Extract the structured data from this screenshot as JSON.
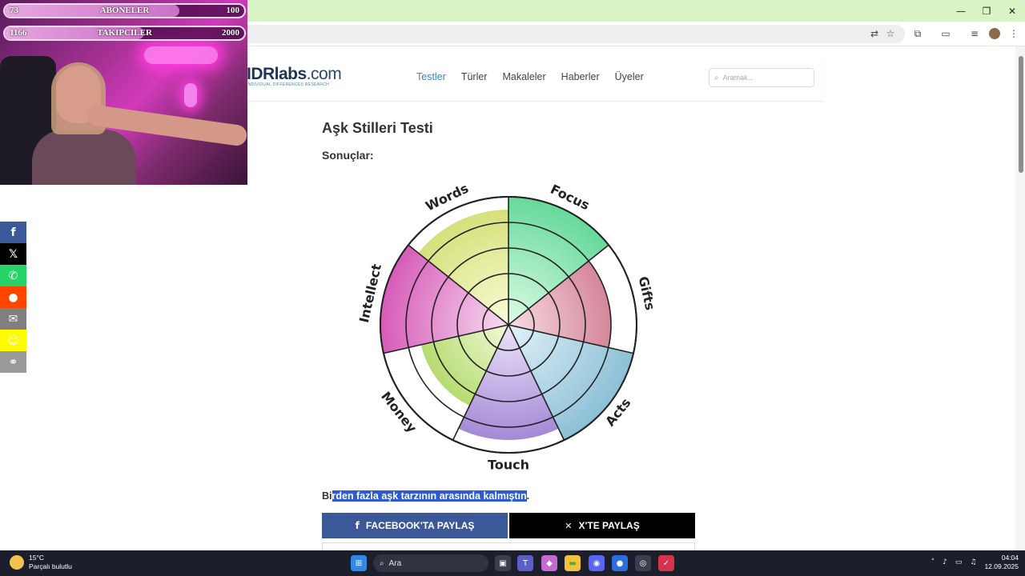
{
  "browser": {
    "window_controls": {
      "minimize": "—",
      "maximize": "❐",
      "close": "✕"
    }
  },
  "site": {
    "logo_main": "IDRlabs",
    "logo_ext": ".com",
    "logo_sub": "INDIVIDUAL DIFFERENCES RESEARCH",
    "nav": [
      "Testler",
      "Türler",
      "Makaleler",
      "Haberler",
      "Üyeler"
    ],
    "active_nav": "Testler",
    "search_placeholder": "Aramak..."
  },
  "content": {
    "title": "Aşk Stilleri Testi",
    "results_label": "Sonuçlar:",
    "result_prefix": "Bi",
    "result_selected": "rden fazla aşk tarzının arasında kalmıştın",
    "result_suffix": ".",
    "facebook_share": "FACEBOOK'TA PAYLAŞ",
    "x_share": "X'TE PAYLAŞ"
  },
  "chart_data": {
    "type": "polar-area",
    "levels": 5,
    "categories": [
      "Focus",
      "Gifts",
      "Acts",
      "Touch",
      "Money",
      "Intellect",
      "Words"
    ],
    "values": [
      5,
      4,
      5,
      4.5,
      3.5,
      5,
      4.5
    ],
    "max": 5,
    "colors": [
      "#66d99a",
      "#d5869a",
      "#8dc0d6",
      "#a48ad6",
      "#b6db70",
      "#d65cb8",
      "#d6e07a"
    ],
    "light_colors": [
      "#dffce6",
      "#f7dde2",
      "#e1f2f8",
      "#ece4fa",
      "#f0fad8",
      "#f8dcf1",
      "#fbfcd9"
    ]
  },
  "webcam": {
    "stats": [
      {
        "left": "73",
        "label": "ABONELER",
        "right": "100",
        "fill": 0.73
      },
      {
        "left": "1166",
        "label": "TAKIPCILER",
        "right": "2000",
        "fill": 0.583
      }
    ]
  },
  "social_icons": [
    {
      "name": "facebook-icon",
      "glyph": "f",
      "color": "#3b5998"
    },
    {
      "name": "x-icon",
      "glyph": "𝕏",
      "color": "#000000"
    },
    {
      "name": "whatsapp-icon",
      "glyph": "✆",
      "color": "#25d366"
    },
    {
      "name": "reddit-icon",
      "glyph": "●",
      "color": "#ff4500"
    },
    {
      "name": "email-icon",
      "glyph": "✉",
      "color": "#7f7f7f"
    },
    {
      "name": "snapchat-icon",
      "glyph": "☺",
      "color": "#fffc00"
    },
    {
      "name": "link-icon",
      "glyph": "⚭",
      "color": "#9a9a9a"
    }
  ],
  "taskbar": {
    "temperature": "15°C",
    "weather": "Parçalı bulutlu",
    "search": "Ara",
    "time": "04:04",
    "date": "12.09.2025"
  }
}
